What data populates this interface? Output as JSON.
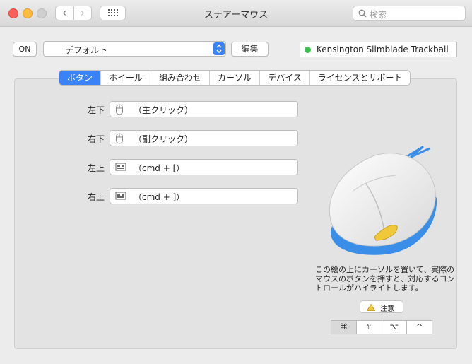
{
  "window": {
    "title": "ステアーマウス"
  },
  "search": {
    "placeholder": "検索"
  },
  "toolbar": {
    "on_label": "ON",
    "preset": "デフォルト",
    "edit_label": "編集"
  },
  "device": {
    "name": "Kensington Slimblade Trackball",
    "status_color": "#3dbf4f"
  },
  "tabs": [
    {
      "label": "ボタン",
      "active": true
    },
    {
      "label": "ホイール"
    },
    {
      "label": "組み合わせ"
    },
    {
      "label": "カーソル"
    },
    {
      "label": "デバイス"
    },
    {
      "label": "ライセンスとサポート"
    }
  ],
  "buttons": [
    {
      "label": "左下",
      "icon": "mouse-icon",
      "action": "（主クリック）"
    },
    {
      "label": "右下",
      "icon": "mouse-icon",
      "action": "（副クリック）"
    },
    {
      "label": "左上",
      "icon": "keyboard-shortcut-icon",
      "action": "（cmd + [）"
    },
    {
      "label": "右上",
      "icon": "keyboard-shortcut-icon",
      "action": "（cmd + ]）"
    }
  ],
  "description": "この絵の上にカーソルを置いて、実際のマウスのボタンを押すと、対応するコントロールがハイライトします。",
  "warning": {
    "label": "注意"
  },
  "modifier_keys": [
    "⌘",
    "⇧",
    "⌥",
    "^"
  ],
  "colors": {
    "accent": "#3a82f7",
    "mouse_highlight": "#f0c93a",
    "mouse_base": "#3b8ee8"
  }
}
